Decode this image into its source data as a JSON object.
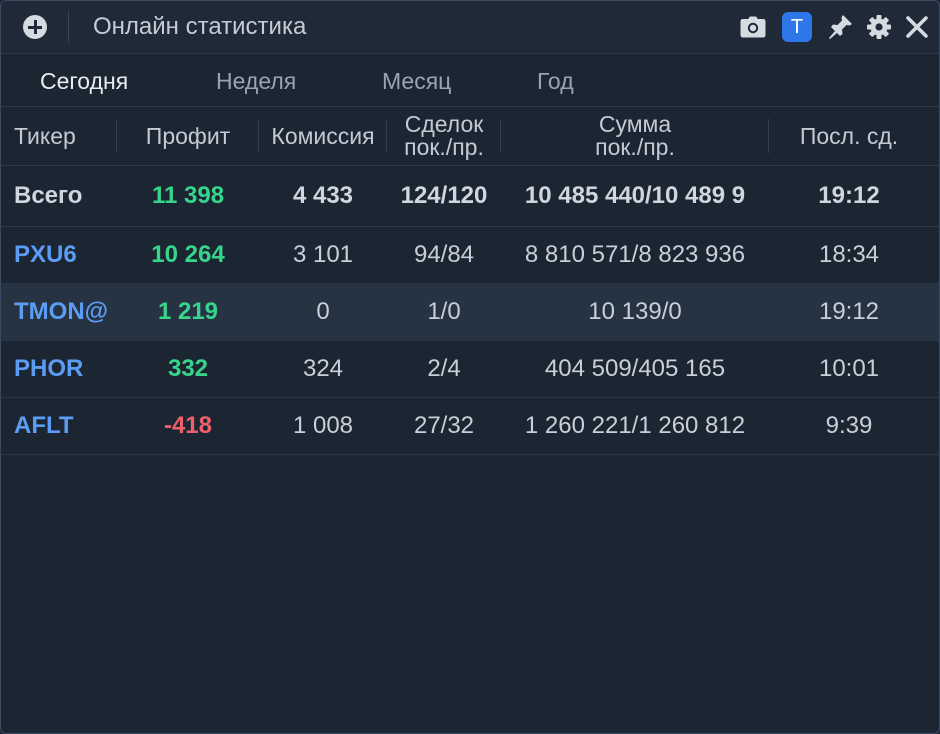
{
  "window": {
    "title": "Онлайн статистика",
    "badge_label": "T"
  },
  "toolbar_icons": [
    "camera-icon",
    "t-badge-icon",
    "pin-icon",
    "gear-icon",
    "close-icon"
  ],
  "tabs": [
    {
      "label": "Сегодня",
      "active": true
    },
    {
      "label": "Неделя",
      "active": false
    },
    {
      "label": "Месяц",
      "active": false
    },
    {
      "label": "Год",
      "active": false
    }
  ],
  "table": {
    "columns": [
      {
        "line1": "Тикер",
        "line2": ""
      },
      {
        "line1": "Профит",
        "line2": ""
      },
      {
        "line1": "Комиссия",
        "line2": ""
      },
      {
        "line1": "Сделок",
        "line2": "пок./пр."
      },
      {
        "line1": "Сумма",
        "line2": "пок./пр."
      },
      {
        "line1": "Посл. сд.",
        "line2": ""
      }
    ],
    "total": {
      "label": "Всего",
      "profit": "11 398",
      "commission": "4 433",
      "deals": "124/120",
      "sum": "10 485 440/10 489 9",
      "last": "19:12"
    },
    "rows": [
      {
        "ticker": "PXU6",
        "profit": "10 264",
        "commission": "3 101",
        "deals": "94/84",
        "sum": "8 810 571/8 823 936",
        "last": "18:34"
      },
      {
        "ticker": "TMON@",
        "profit": "1 219",
        "commission": "0",
        "deals": "1/0",
        "sum": "10 139/0",
        "last": "19:12"
      },
      {
        "ticker": "PHOR",
        "profit": "332",
        "commission": "324",
        "deals": "2/4",
        "sum": "404 509/405 165",
        "last": "10:01"
      },
      {
        "ticker": "AFLT",
        "profit": "-418",
        "commission": "1 008",
        "deals": "27/32",
        "sum": "1 260 221/1 260 812",
        "last": "9:39"
      }
    ]
  },
  "colors": {
    "background": "#1c2633",
    "ticker": "#5b9cf5",
    "profit_positive": "#37d58c",
    "profit_negative": "#f0606c",
    "badge": "#2f76e8"
  }
}
